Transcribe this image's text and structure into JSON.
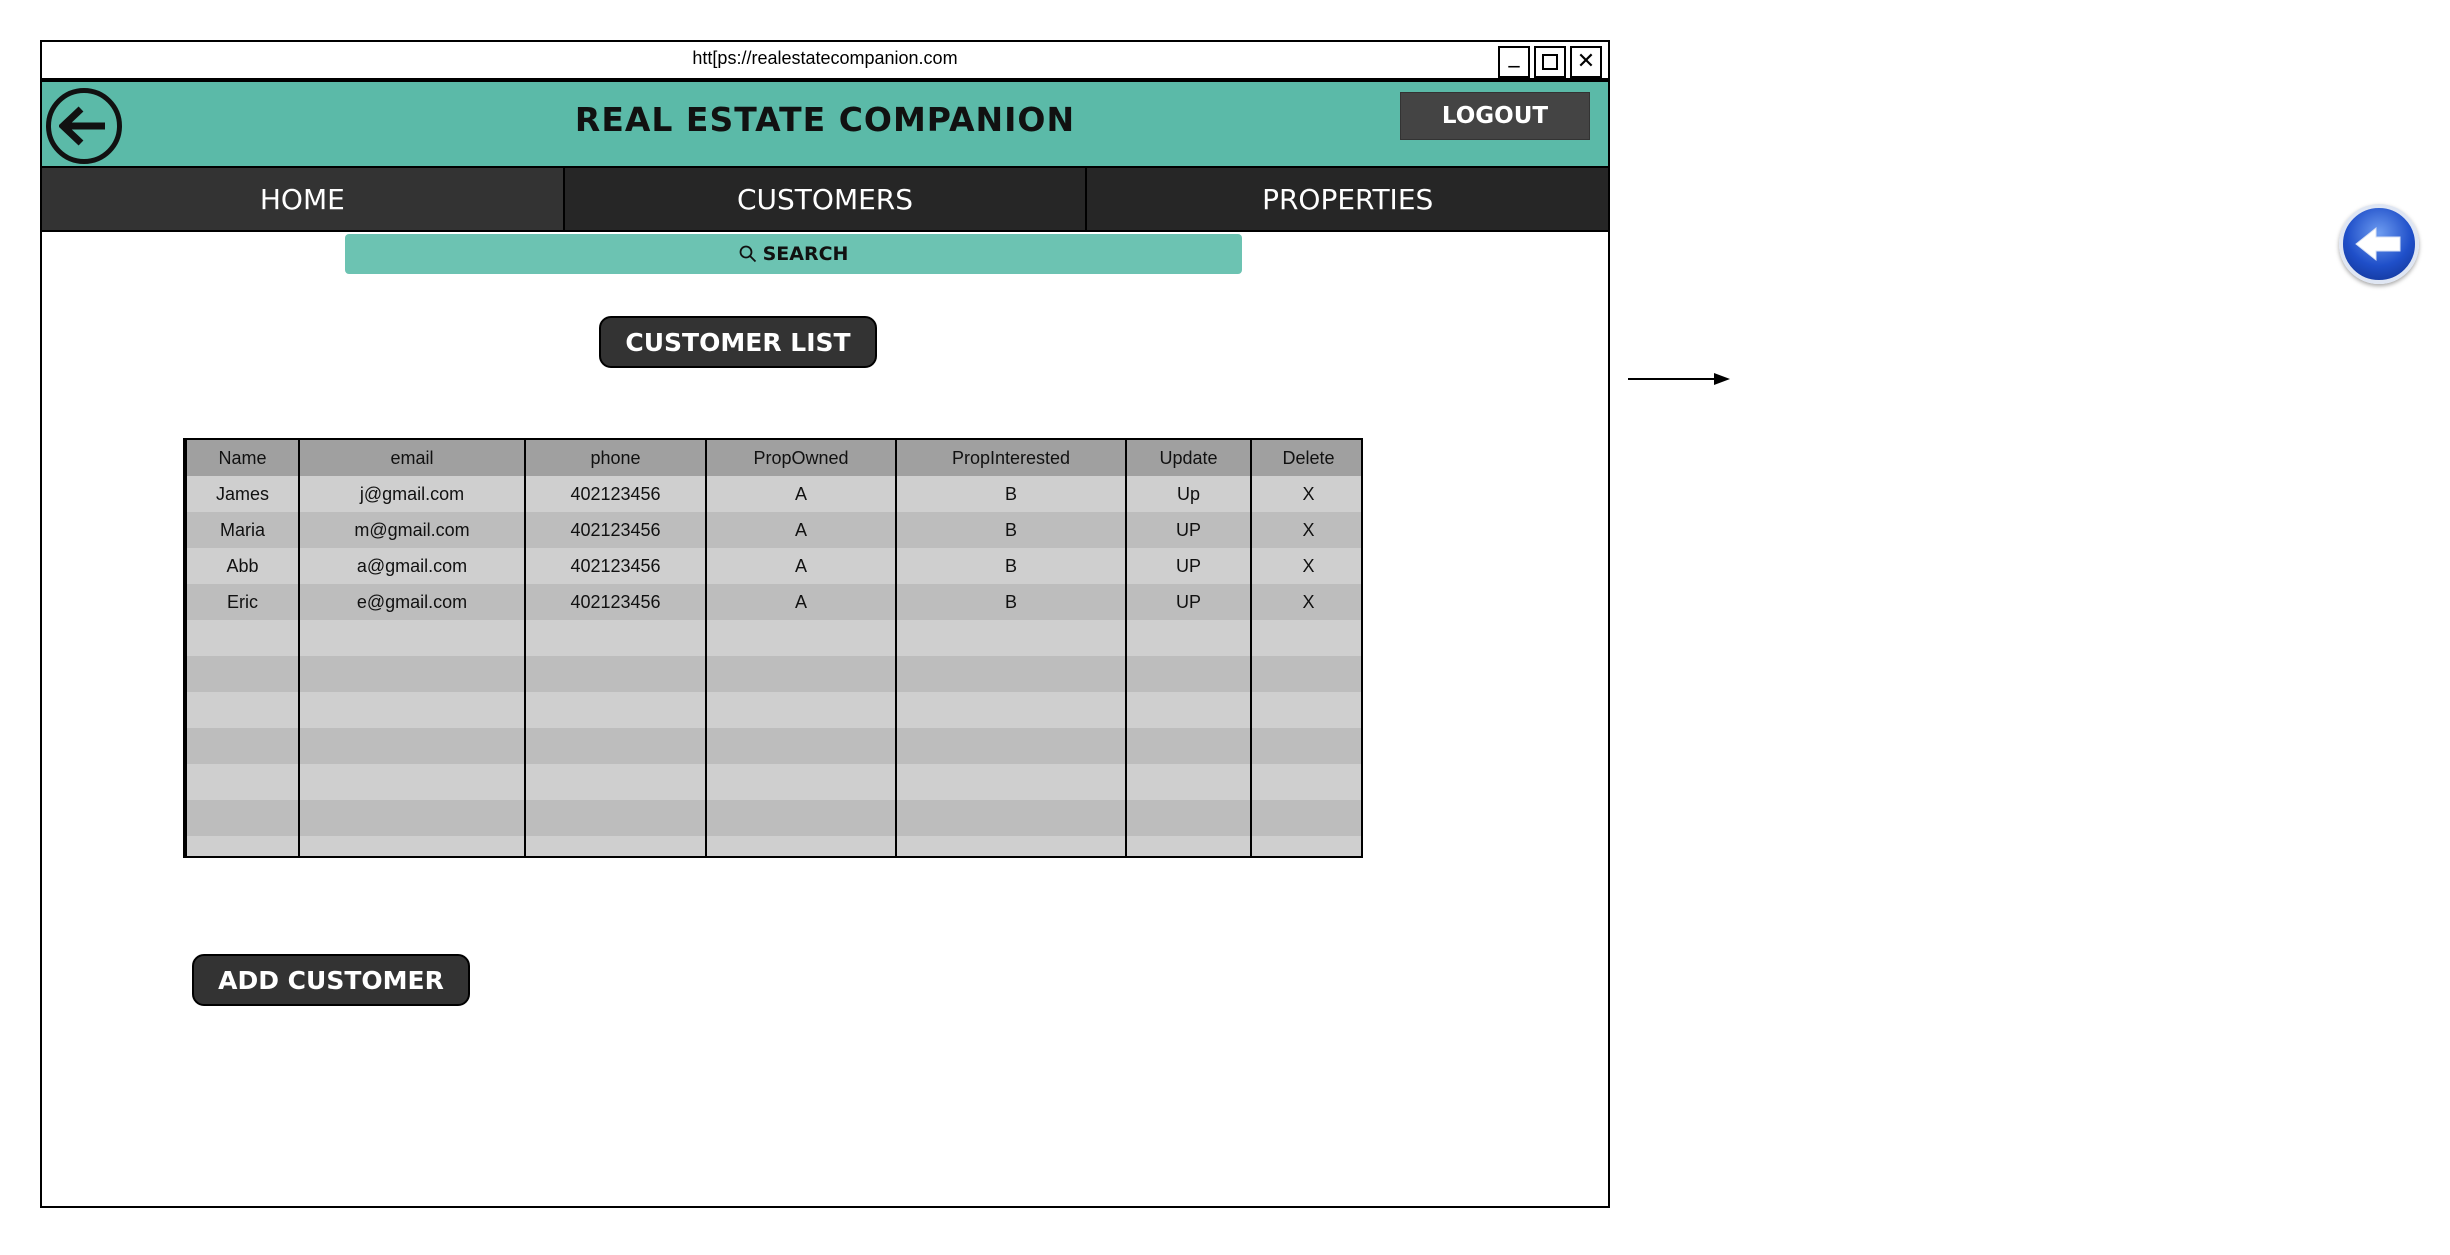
{
  "browser": {
    "url": "htt[ps://realestatecompanion.com",
    "minimize_label": "_",
    "maximize_icon": "square-icon",
    "close_label": "✕"
  },
  "header": {
    "title": "REAL ESTATE COMPANION",
    "logout_label": "LOGOUT",
    "back_icon": "arrow-left-icon",
    "accent_color": "#5bbaa8"
  },
  "nav": {
    "items": [
      {
        "label": "HOME"
      },
      {
        "label": "CUSTOMERS"
      },
      {
        "label": "PROPERTIES"
      }
    ]
  },
  "search": {
    "label": "SEARCH",
    "icon": "search-icon"
  },
  "customer_list_button": "CUSTOMER LIST",
  "table": {
    "columns": [
      "Name",
      "email",
      "phone",
      "PropOwned",
      "PropInterested",
      "Update",
      "Delete"
    ],
    "rows": [
      [
        "James",
        "j@gmail.com",
        "402123456",
        "A",
        "B",
        "Up",
        "X"
      ],
      [
        "Maria",
        "m@gmail.com",
        "402123456",
        "A",
        "B",
        "UP",
        "X"
      ],
      [
        "Abb",
        "a@gmail.com",
        "402123456",
        "A",
        "B",
        "UP",
        "X"
      ],
      [
        "Eric",
        "e@gmail.com",
        "402123456",
        "A",
        "B",
        "UP",
        "X"
      ],
      [
        "",
        "",
        "",
        "",
        "",
        "",
        ""
      ],
      [
        "",
        "",
        "",
        "",
        "",
        "",
        ""
      ],
      [
        "",
        "",
        "",
        "",
        "",
        "",
        ""
      ],
      [
        "",
        "",
        "",
        "",
        "",
        "",
        ""
      ],
      [
        "",
        "",
        "",
        "",
        "",
        "",
        ""
      ],
      [
        "",
        "",
        "",
        "",
        "",
        "",
        ""
      ],
      [
        "",
        "",
        "",
        "",
        "",
        "",
        ""
      ]
    ]
  },
  "add_customer_button": "ADD CUSTOMER"
}
